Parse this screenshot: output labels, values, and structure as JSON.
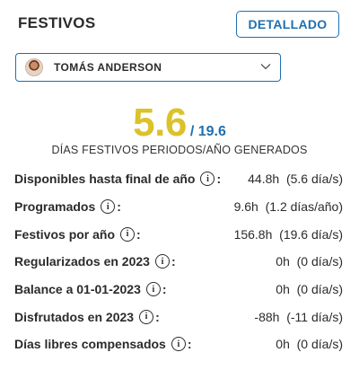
{
  "header": {
    "title": "FESTIVOS",
    "detail_button": "DETALLADO"
  },
  "employee_select": {
    "selected": "TOMÁS ANDERSON",
    "chevron_icon": "chevron-down-icon",
    "avatar_icon": "user-avatar"
  },
  "summary": {
    "generated_value": "5.6",
    "total_value": "/ 19.6",
    "caption": "DÍAS FESTIVOS PERIODOS/AÑO GENERADOS",
    "value_color": "#dcc22a",
    "total_color": "#1f6fb0"
  },
  "rows": [
    {
      "label": "Disponibles hasta final de año",
      "hours": "44.8h",
      "days": "(5.6 día/s)"
    },
    {
      "label": "Programados",
      "hours": "9.6h",
      "days": "(1.2 días/año)"
    },
    {
      "label": "Festivos por año",
      "hours": "156.8h",
      "days": "(19.6 día/s)"
    },
    {
      "label": "Regularizados en 2023",
      "hours": "0h",
      "days": "(0 día/s)"
    },
    {
      "label": "Balance a 01-01-2023",
      "hours": "0h",
      "days": "(0 día/s)"
    },
    {
      "label": "Disfrutados en 2023",
      "hours": "-88h",
      "days": "(-11 día/s)"
    },
    {
      "label": "Días libres compensados",
      "hours": "0h",
      "days": "(0 día/s)"
    }
  ],
  "info_icon_glyph": "i",
  "colon": ":"
}
